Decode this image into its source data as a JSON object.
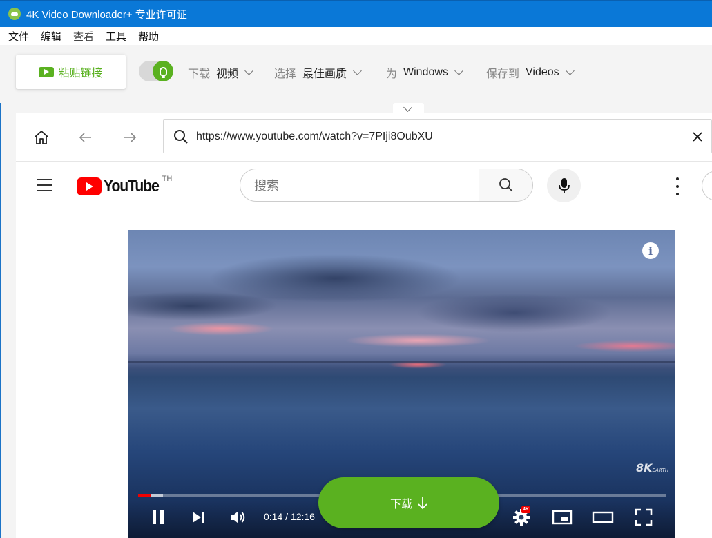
{
  "window": {
    "title": "4K Video Downloader+ 专业许可证"
  },
  "menu": {
    "items": [
      "文件",
      "编辑",
      "查看",
      "工具",
      "帮助"
    ]
  },
  "toolbar": {
    "paste_label": "粘贴链接",
    "smart_mode_on": true,
    "options": [
      {
        "key": "下载",
        "value": "视频"
      },
      {
        "key": "选择",
        "value": "最佳画质"
      },
      {
        "key": "为",
        "value": "Windows"
      },
      {
        "key": "保存到",
        "value": "Videos"
      }
    ]
  },
  "browser": {
    "url": "https://www.youtube.com/watch?v=7PIji8OubXU"
  },
  "youtube": {
    "logo_text": "YouTube",
    "region": "TH",
    "search_placeholder": "搜索"
  },
  "player": {
    "time": "0:14 / 12:16",
    "quality_badge": "4K",
    "watermark": "8K",
    "watermark_small": "EARTH",
    "info_glyph": "i",
    "progress_played_fraction": 0.023,
    "progress_buffered_fraction": 0.047
  },
  "download": {
    "label": "下载"
  },
  "colors": {
    "titlebar": "#0a78d7",
    "accent_green": "#5ab120",
    "youtube_red": "#ff0000"
  }
}
